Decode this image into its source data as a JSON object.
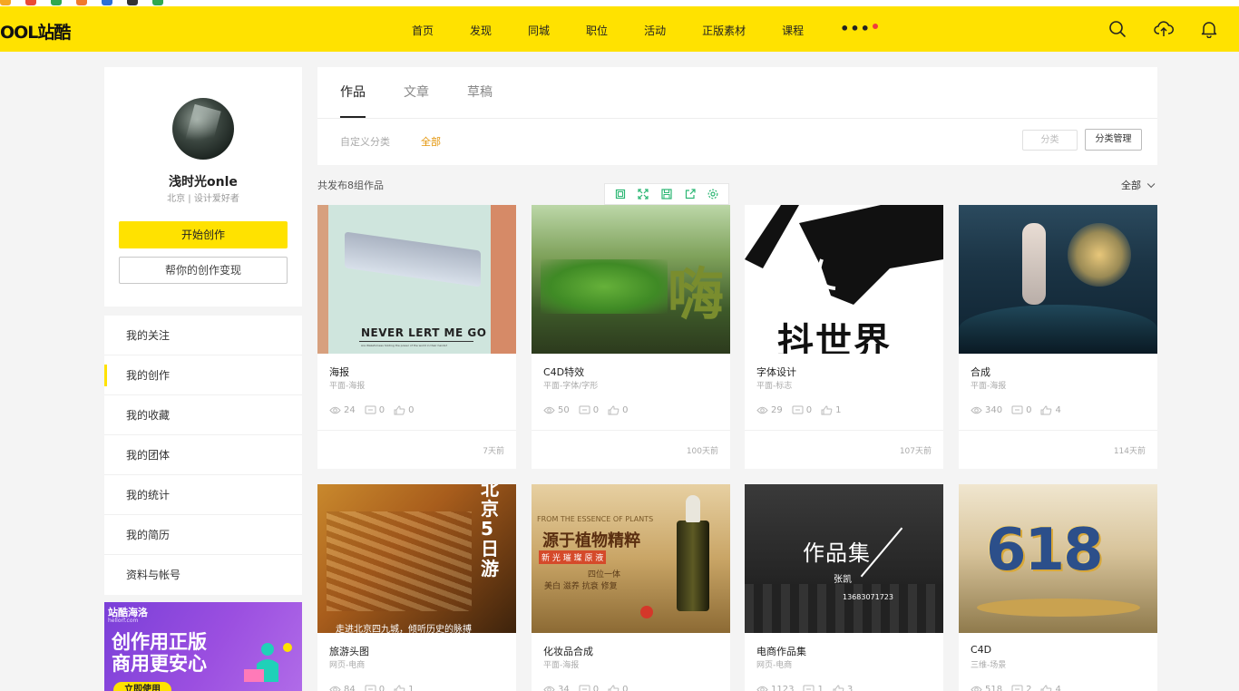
{
  "header": {
    "logo": "OOL站酷",
    "nav": [
      "首页",
      "发现",
      "同城",
      "职位",
      "活动",
      "正版素材",
      "课程"
    ],
    "nav_more": "•••"
  },
  "profile": {
    "name": "浅时光onle",
    "info": "北京 | 设计爱好者",
    "start_button": "开始创作",
    "monetize_button": "帮你的创作变现"
  },
  "menu": [
    "我的关注",
    "我的创作",
    "我的收藏",
    "我的团体",
    "我的统计",
    "我的简历",
    "资料与帐号"
  ],
  "promo": {
    "brand": "站酷海洛",
    "url": "hellorf.com",
    "title": "创作用正版 商用更安心",
    "button": "立即使用"
  },
  "tabs": [
    "作品",
    "文章",
    "草稿"
  ],
  "filter": {
    "label": "自定义分类",
    "all": "全部",
    "category_button": "分类",
    "manage_button": "分类管理"
  },
  "works_count": "共发布8组作品",
  "sort": "全部",
  "works": [
    {
      "title": "海报",
      "category": "平面-海报",
      "views": "24",
      "comments": "0",
      "likes": "0",
      "time": "7天前",
      "thumb_text": "NEVER LERT ME GO",
      "thumb_subtext": "Are Wakefulness holding the power of the world in their hands?"
    },
    {
      "title": "C4D特效",
      "category": "平面-字体/字形",
      "views": "50",
      "comments": "0",
      "likes": "0",
      "time": "100天前",
      "thumb_text": "嗨"
    },
    {
      "title": "字体设计",
      "category": "平面-标志",
      "views": "29",
      "comments": "0",
      "likes": "1",
      "time": "107天前",
      "thumb_text": "抖世界"
    },
    {
      "title": "合成",
      "category": "平面-海报",
      "views": "340",
      "comments": "0",
      "likes": "4",
      "time": "114天前"
    },
    {
      "title": "旅游头图",
      "category": "网页-电商",
      "views": "84",
      "comments": "0",
      "likes": "1",
      "time": "",
      "thumb_text": "北京5日游",
      "thumb_subtext": "走进北京四九城，倾听历史的脉搏"
    },
    {
      "title": "化妆品合成",
      "category": "平面-海报",
      "views": "34",
      "comments": "0",
      "likes": "0",
      "time": "",
      "thumb_text": "源于植物精粹",
      "thumb_subtext": "FROM THE ESSENCE OF PLANTS",
      "thumb_tag": "新 光 璀 璨 原 液",
      "thumb_line1": "四位一体",
      "thumb_line2": "美白  滋养  抗衰  修复"
    },
    {
      "title": "电商作品集",
      "category": "网页-电商",
      "views": "1123",
      "comments": "1",
      "likes": "3",
      "time": "",
      "thumb_text": "作品集",
      "thumb_subtext": "张凯",
      "thumb_line1": "13683071723"
    },
    {
      "title": "C4D",
      "category": "三维-场景",
      "views": "518",
      "comments": "2",
      "likes": "4",
      "time": "",
      "thumb_text": "618"
    }
  ],
  "colors": {
    "brand_yellow": "#ffe200",
    "accent_orange": "#e3950a",
    "notify_red": "#f03c3c"
  }
}
